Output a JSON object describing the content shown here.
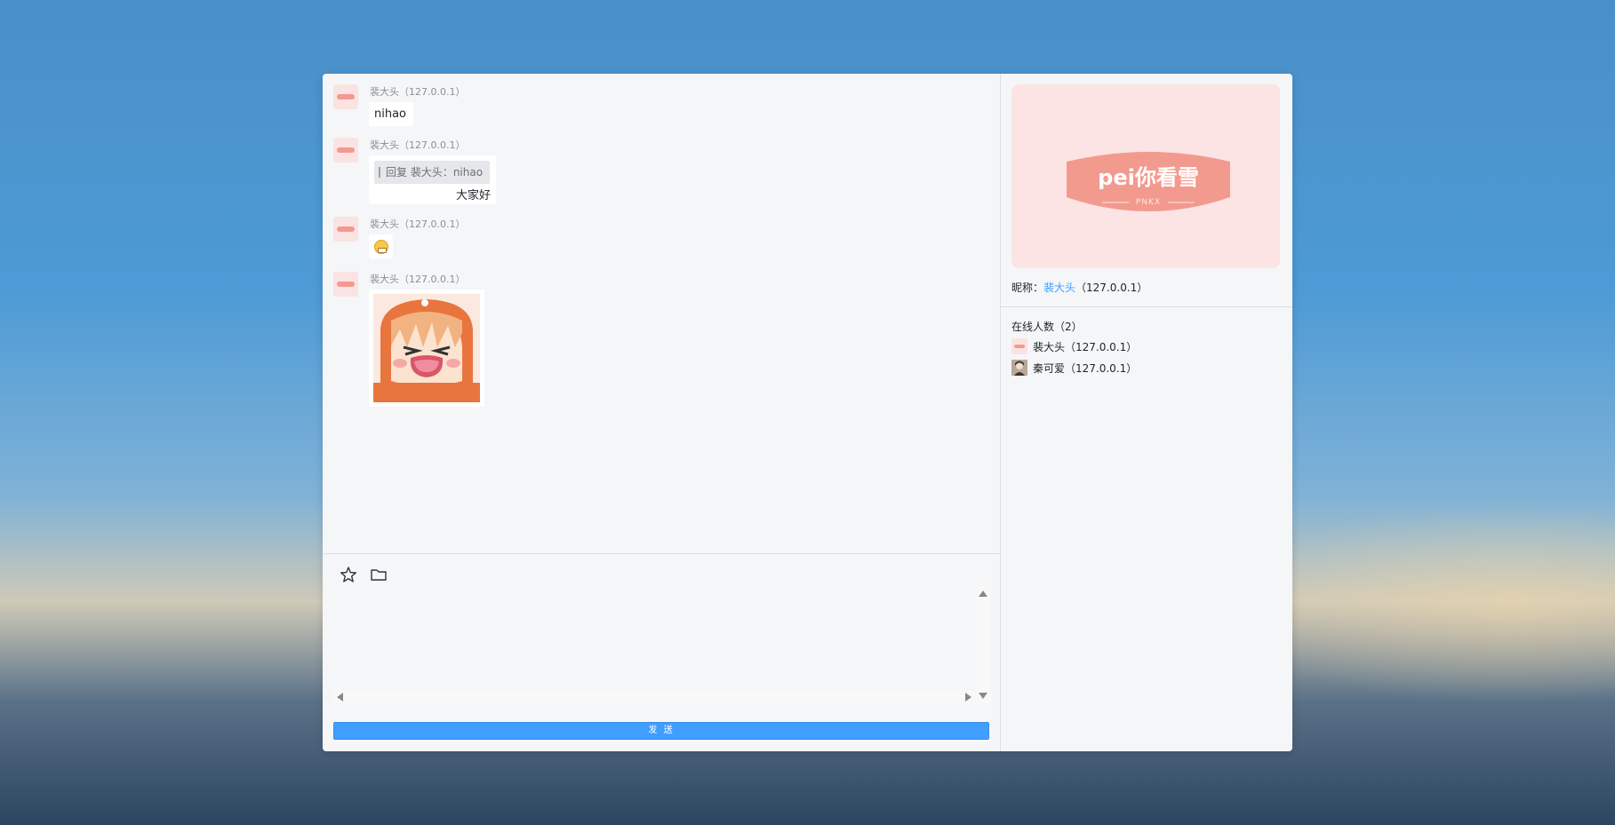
{
  "messages": [
    {
      "sender": "裴大头",
      "ip": "（127.0.0.1）",
      "text": "nihao"
    },
    {
      "sender": "裴大头",
      "ip": "（127.0.0.1）",
      "quote": "回复 裴大头：nihao",
      "text": "大家好"
    },
    {
      "sender": "裴大头",
      "ip": "（127.0.0.1）",
      "emoji": "grinning-face-emoji"
    },
    {
      "sender": "裴大头",
      "ip": "（127.0.0.1）",
      "image": "anime-crying-girl-sticker"
    }
  ],
  "toolbar": {
    "emoji_icon": "star-icon",
    "file_icon": "folder-icon"
  },
  "input": {
    "value": "",
    "placeholder": ""
  },
  "send_label": "发 送",
  "profile": {
    "banner_title": "pei你看雪",
    "banner_sub": "PNKX",
    "nick_label": "昵称：",
    "nick_name": "裴大头",
    "nick_ip": "（127.0.0.1）"
  },
  "online": {
    "title": "在线人数（2）",
    "users": [
      {
        "name": "裴大头（127.0.0.1）"
      },
      {
        "name": "秦可爱（127.0.0.1）"
      }
    ]
  },
  "colors": {
    "accent": "#409eff",
    "banner_bg": "#fbe4e3",
    "badge": "#f39a8f"
  }
}
